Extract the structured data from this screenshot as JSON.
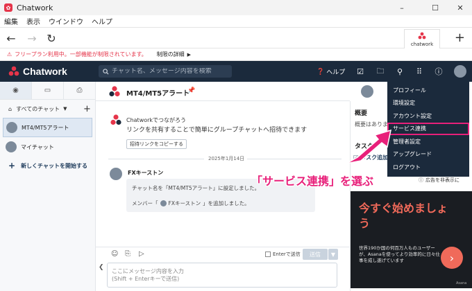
{
  "window": {
    "title": "Chatwork",
    "minimize_glyph": "–",
    "maximize_glyph": "☐",
    "close_glyph": "✕"
  },
  "menubar": {
    "items": [
      "編集",
      "表示",
      "ウインドウ",
      "ヘルプ"
    ]
  },
  "browser": {
    "back_glyph": "←",
    "forward_glyph": "→",
    "reload_glyph": "↻",
    "tab_label": "chatwork",
    "new_tab_glyph": "+"
  },
  "notice": {
    "text": "フリープラン利用中。一部機能が制限されています。",
    "details": "制限の詳細"
  },
  "header": {
    "brand": "Chatwork",
    "search_placeholder": "チャット名、メッセージ内容を検索",
    "help_label": "ヘルプ"
  },
  "sidebar": {
    "all_chats_label": "すべてのチャット",
    "chats": [
      {
        "name": "MT4/MT5アラート",
        "active": true
      },
      {
        "name": "マイチャット",
        "active": false
      }
    ],
    "new_chat_label": "新しくチャットを開始する"
  },
  "room": {
    "name": "MT4/MT5アラート"
  },
  "timeline": {
    "promo_title": "Chatworkでつながろう",
    "promo_body": "リンクを共有することで簡単にグループチャットへ招待できます",
    "copy_link_button": "招待リンクをコピーする",
    "date": "2025年1月14日",
    "sender": "FXキーストン",
    "sys_line1": "チャット名を「MT4/MT5アラート」に設定しました。",
    "sys_line2_prefix": "メンバー「",
    "sys_line2_name": "FXキーストン",
    "sys_line2_suffix": "」を追加しました。"
  },
  "composer": {
    "enter_send_label": "Enterで送信",
    "send_label": "送信",
    "input_placeholder_1": "ここにメッセージ内容を入力",
    "input_placeholder_2": "(Shift + Enterキーで送信)"
  },
  "right_panel": {
    "summary_title": "概要",
    "summary_body": "概要はありません",
    "task_title": "タスク",
    "task_tab": "タスク追加",
    "ad_hide": "広告を非表示に"
  },
  "ad": {
    "headline": "今すぐ始めましょう",
    "copy": "世界190か国の何百万人ものユーザーが、Asanaを使ってより効率的に日々仕事を成し遂げています",
    "cta_glyph": "›",
    "footer": "Asana"
  },
  "dropdown": {
    "items": [
      "プロフィール",
      "環境設定",
      "アカウント設定",
      "サービス連携",
      "管理者設定",
      "アップグレード",
      "ログアウト"
    ],
    "highlighted_index": 3
  },
  "annotation": {
    "text": "「サービス連携」を選ぶ",
    "color": "#e8207a"
  },
  "colors": {
    "header_bg": "#1b2a3c",
    "brand_red": "#e5354a",
    "accent_pink": "#e8207a"
  }
}
